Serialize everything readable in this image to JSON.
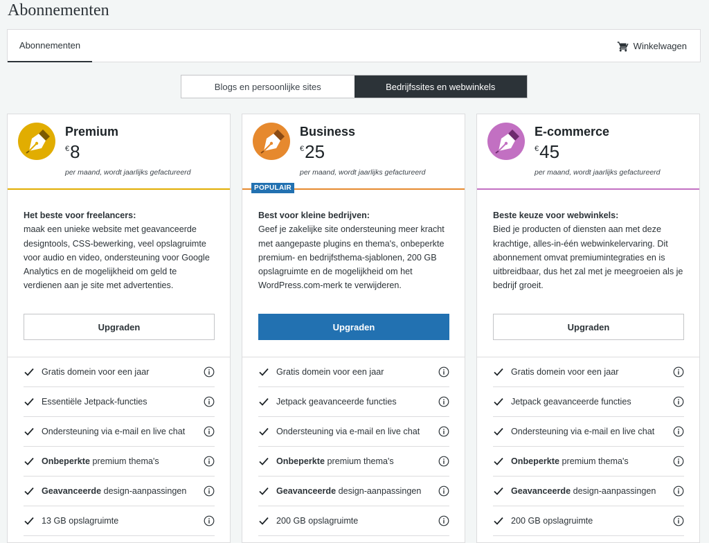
{
  "page": {
    "title": "Abonnementen"
  },
  "tabs": {
    "active": "Abonnementen",
    "cart": "Winkelwagen"
  },
  "toggle": {
    "left": "Blogs en persoonlijke sites",
    "right": "Bedrijfssites en webwinkels"
  },
  "colors": {
    "premium": "#e1ad01",
    "business": "#e6892e",
    "ecommerce": "#c270c2",
    "primary": "#2271b1"
  },
  "plans": [
    {
      "name": "Premium",
      "currency": "€",
      "price": "8",
      "billing": "per maand, wordt jaarlijks gefactureerd",
      "desc_title": "Het beste voor freelancers:",
      "desc": "maak een unieke website met geavanceerde designtools, CSS-bewerking, veel opslagruimte voor audio en video, ondersteuning voor Google Analytics en de mogelijkheid om geld te verdienen aan je site met advertenties.",
      "button": "Upgraden",
      "features": [
        {
          "bold": "",
          "text": "Gratis domein voor een jaar"
        },
        {
          "bold": "",
          "text": "Essentiële Jetpack-functies"
        },
        {
          "bold": "",
          "text": "Ondersteuning via e-mail en live chat"
        },
        {
          "bold": "Onbeperkte",
          "text": " premium thema's"
        },
        {
          "bold": "Geavanceerde",
          "text": " design-aanpassingen"
        },
        {
          "bold": "",
          "text": "13 GB opslagruimte"
        }
      ]
    },
    {
      "name": "Business",
      "currency": "€",
      "price": "25",
      "billing": "per maand, wordt jaarlijks gefactureerd",
      "badge": "POPULAIR",
      "desc_title": "Best voor kleine bedrijven:",
      "desc": "Geef je zakelijke site ondersteuning meer kracht met aangepaste plugins en thema's, onbeperkte premium- en bedrijfsthema-sjablonen, 200 GB opslagruimte en de mogelijkheid om het WordPress.com-merk te verwijderen.",
      "button": "Upgraden",
      "features": [
        {
          "bold": "",
          "text": "Gratis domein voor een jaar"
        },
        {
          "bold": "",
          "text": "Jetpack geavanceerde functies"
        },
        {
          "bold": "",
          "text": "Ondersteuning via e-mail en live chat"
        },
        {
          "bold": "Onbeperkte",
          "text": " premium thema's"
        },
        {
          "bold": "Geavanceerde",
          "text": " design-aanpassingen"
        },
        {
          "bold": "",
          "text": "200 GB opslagruimte"
        }
      ]
    },
    {
      "name": "E-commerce",
      "currency": "€",
      "price": "45",
      "billing": "per maand, wordt jaarlijks gefactureerd",
      "desc_title": "Beste keuze voor webwinkels:",
      "desc": "Bied je producten of diensten aan met deze krachtige, alles-in-één webwinkelervaring. Dit abonnement omvat premiumintegraties en is uitbreidbaar, dus het zal met je meegroeien als je bedrijf groeit.",
      "button": "Upgraden",
      "features": [
        {
          "bold": "",
          "text": "Gratis domein voor een jaar"
        },
        {
          "bold": "",
          "text": "Jetpack geavanceerde functies"
        },
        {
          "bold": "",
          "text": "Ondersteuning via e-mail en live chat"
        },
        {
          "bold": "Onbeperkte",
          "text": " premium thema's"
        },
        {
          "bold": "Geavanceerde",
          "text": " design-aanpassingen"
        },
        {
          "bold": "",
          "text": "200 GB opslagruimte"
        }
      ]
    }
  ]
}
